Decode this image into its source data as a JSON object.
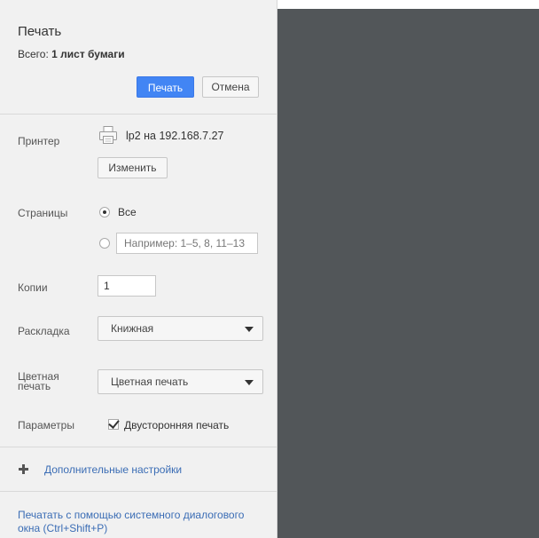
{
  "header": {
    "title": "Печать",
    "total_label": "Всего:",
    "total_value": "1 лист бумаги",
    "print_button": "Печать",
    "cancel_button": "Отмена"
  },
  "printer": {
    "label": "Принтер",
    "name": "lp2 на 192.168.7.27",
    "change_button": "Изменить"
  },
  "pages": {
    "label": "Страницы",
    "option_all": "Все",
    "selected": "all",
    "range_placeholder": "Например: 1–5, 8, 11–13"
  },
  "copies": {
    "label": "Копии",
    "value": "1"
  },
  "layout": {
    "label": "Раскладка",
    "value": "Книжная"
  },
  "color": {
    "label": "Цветная печать",
    "value": "Цветная печать"
  },
  "options": {
    "label": "Параметры",
    "duplex_label": "Двусторонняя печать",
    "duplex_checked": true
  },
  "advanced_link": "Дополнительные настройки",
  "system_dialog_link": "Печатать с помощью системного диалогового окна (Ctrl+Shift+P)",
  "colors": {
    "accent": "#4285f4",
    "link": "#3b6db5",
    "preview_background": "#525659",
    "sidebar_background": "#f1f1f1"
  },
  "icons": {
    "printer": "printer-icon",
    "dropdown": "chevron-down-icon",
    "expand": "plus-icon"
  }
}
